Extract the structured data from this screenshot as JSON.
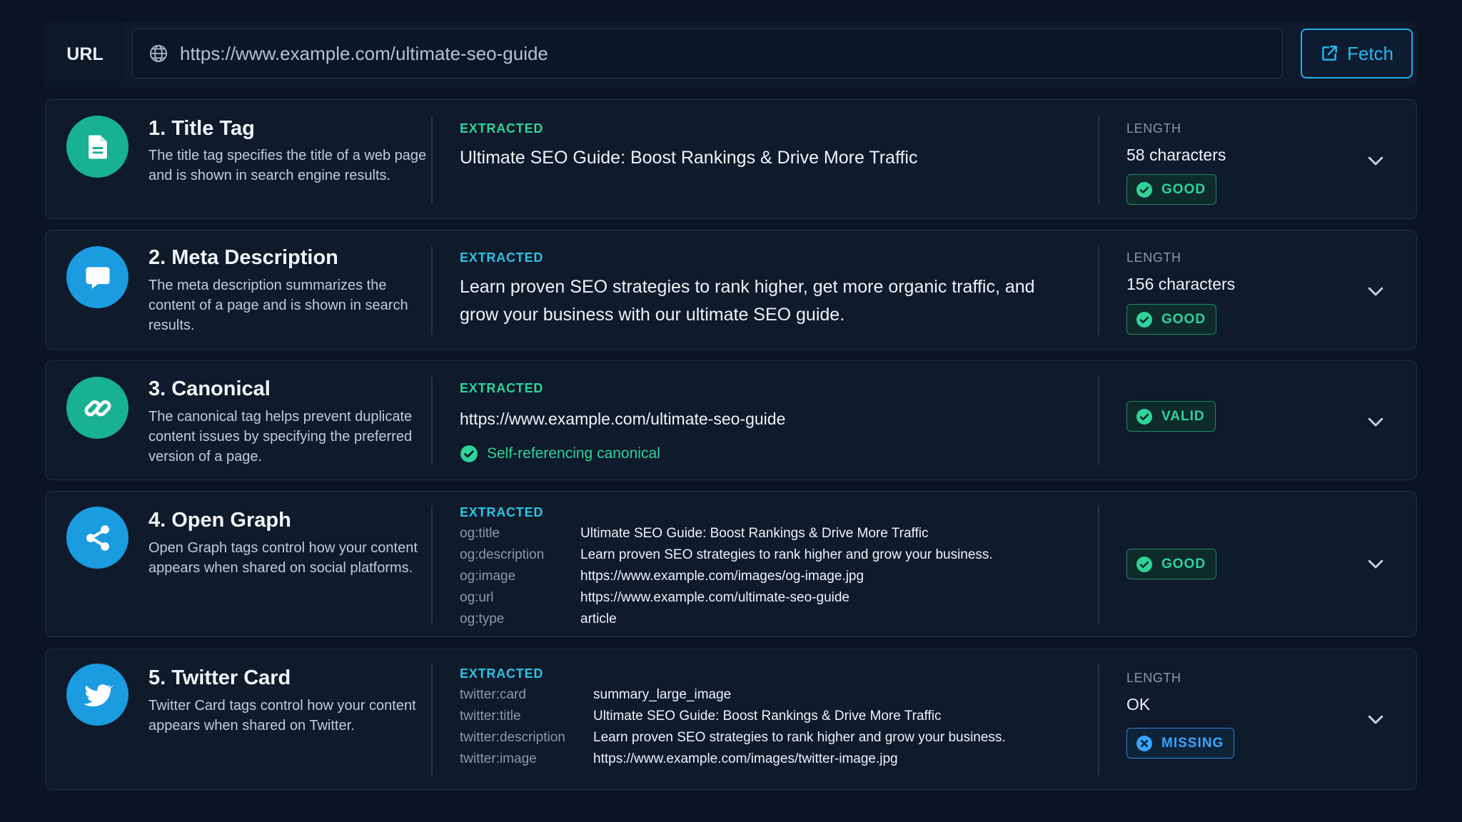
{
  "urlbar": {
    "label": "URL",
    "value": "https://www.example.com/ultimate-seo-guide",
    "fetch_label": "Fetch"
  },
  "colors": {
    "accent": "#28b8f2",
    "good": "#2fd39a",
    "missing": "#3aa5ff",
    "teal_icon": "#18b192",
    "blue_icon": "#1b9be0"
  },
  "cards": [
    {
      "title": "1. Title Tag",
      "description": "The title tag specifies the title of a web page and is shown in search engine results.",
      "icon": "document-icon",
      "extracted_label": "EXTRACTED",
      "extracted_text": "Ultimate SEO Guide: Boost Rankings & Drive More Traffic",
      "length_label": "LENGTH",
      "length_value": "58 characters",
      "badge": "GOOD"
    },
    {
      "title": "2. Meta Description",
      "description": "The meta description summarizes the content of a page and is shown in search results.",
      "icon": "chat-bubble-icon",
      "extracted_label": "EXTRACTED",
      "extracted_text": "Learn proven SEO strategies to rank higher, get more organic traffic, and grow your business with our ultimate SEO guide.",
      "length_label": "LENGTH",
      "length_value": "156 characters",
      "badge": "GOOD"
    },
    {
      "title": "3. Canonical",
      "description": "The canonical tag helps prevent duplicate content issues by specifying the preferred version of a page.",
      "icon": "link-icon",
      "extracted_label": "EXTRACTED",
      "extracted_text": "https://www.example.com/ultimate-seo-guide",
      "note": "Self-referencing canonical",
      "badge": "VALID"
    },
    {
      "title": "4. Open Graph",
      "description": "Open Graph tags control how your content appears when shared on social platforms.",
      "icon": "share-icon",
      "extracted_label": "EXTRACTED",
      "rows": [
        {
          "key": "og:title",
          "value": "Ultimate SEO Guide: Boost Rankings & Drive More Traffic"
        },
        {
          "key": "og:description",
          "value": "Learn proven SEO strategies to rank higher and grow your business."
        },
        {
          "key": "og:image",
          "value": "https://www.example.com/images/og-image.jpg"
        },
        {
          "key": "og:url",
          "value": "https://www.example.com/ultimate-seo-guide"
        },
        {
          "key": "og:type",
          "value": "article"
        }
      ],
      "badge": "GOOD"
    },
    {
      "title": "5. Twitter Card",
      "description": "Twitter Card tags control how your content appears when shared on Twitter.",
      "icon": "twitter-bird-icon",
      "extracted_label": "EXTRACTED",
      "rows": [
        {
          "key": "twitter:card",
          "value": "summary_large_image"
        },
        {
          "key": "twitter:title",
          "value": "Ultimate SEO Guide: Boost Rankings & Drive More Traffic"
        },
        {
          "key": "twitter:description",
          "value": "Learn proven SEO strategies to rank higher and grow your business."
        },
        {
          "key": "twitter:image",
          "value": "https://www.example.com/images/twitter-image.jpg"
        }
      ],
      "length_label": "LENGTH",
      "length_value": "OK",
      "badge": "MISSING"
    }
  ]
}
